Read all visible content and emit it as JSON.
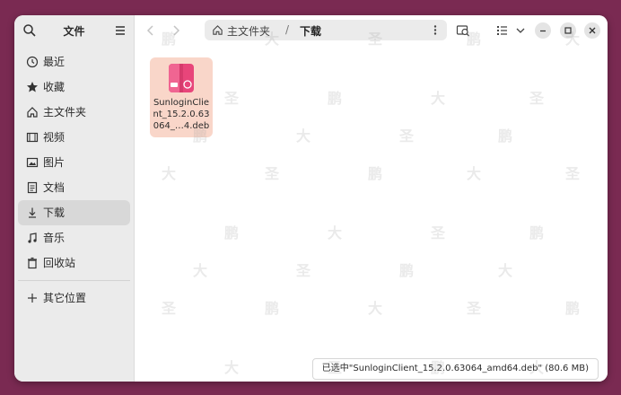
{
  "sidebar": {
    "title": "文件",
    "items": [
      {
        "label": "最近",
        "icon": "clock-icon"
      },
      {
        "label": "收藏",
        "icon": "star-icon"
      },
      {
        "label": "主文件夹",
        "icon": "home-icon"
      },
      {
        "label": "视频",
        "icon": "film-icon"
      },
      {
        "label": "图片",
        "icon": "image-icon"
      },
      {
        "label": "文档",
        "icon": "document-icon"
      },
      {
        "label": "下载",
        "icon": "download-icon",
        "active": true
      },
      {
        "label": "音乐",
        "icon": "music-icon"
      },
      {
        "label": "回收站",
        "icon": "trash-icon"
      }
    ],
    "other": {
      "label": "其它位置",
      "icon": "plus-icon"
    }
  },
  "pathbar": {
    "home_label": "主文件夹",
    "separator": "/",
    "current": "下载"
  },
  "file": {
    "name": "SunloginClient_15.2.0.63064_…4.deb",
    "icon": "deb-package-icon"
  },
  "status": {
    "text": "已选中\"SunloginClient_15.2.0.63064_amd64.deb\"  (80.6 MB)"
  },
  "watermark": {
    "chars": [
      "鹏",
      "大",
      "圣"
    ]
  },
  "colors": {
    "desktop": "#7a2a52",
    "sidebar": "#ebebeb",
    "selection": "#f9d6c9",
    "deb_pink": "#e8457a"
  }
}
